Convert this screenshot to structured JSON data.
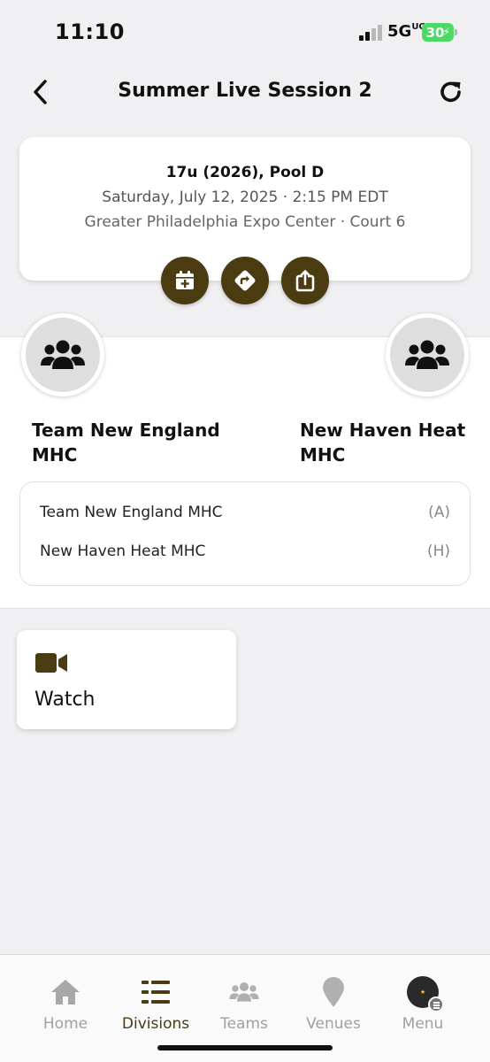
{
  "status_bar": {
    "time": "11:10",
    "network": "5G",
    "network_sup": "UC",
    "battery": "30"
  },
  "header": {
    "title": "Summer Live Session 2",
    "back_icon": "chevron-left-icon",
    "refresh_icon": "refresh-icon"
  },
  "game_info": {
    "division": "17u (2026), Pool D",
    "datetime": "Saturday, July 12, 2025 · 2:15 PM EDT",
    "venue": "Greater Philadelphia Expo Center · Court 6",
    "actions": [
      {
        "icon": "calendar-add-icon"
      },
      {
        "icon": "directions-icon"
      },
      {
        "icon": "share-icon"
      }
    ]
  },
  "teams": {
    "away": {
      "name_line1": "Team New England",
      "name_line2": "MHC",
      "icon": "group-icon"
    },
    "home": {
      "name_line1": "New Haven Heat",
      "name_line2": "MHC",
      "icon": "group-icon"
    }
  },
  "lineup": [
    {
      "name": "Team New England MHC",
      "side": "(A)"
    },
    {
      "name": "New Haven Heat MHC",
      "side": "(H)"
    }
  ],
  "watch": {
    "label": "Watch",
    "icon": "video-camera-icon"
  },
  "tab_bar": {
    "tabs": [
      {
        "label": "Home",
        "icon": "home-icon",
        "active": false
      },
      {
        "label": "Divisions",
        "icon": "list-icon",
        "active": true
      },
      {
        "label": "Teams",
        "icon": "teams-icon",
        "active": false
      },
      {
        "label": "Venues",
        "icon": "map-pin-icon",
        "active": false
      },
      {
        "label": "Menu",
        "icon": "menu-logo-icon",
        "active": false
      }
    ]
  },
  "colors": {
    "accent": "#4a3b10",
    "background": "#f0f0f2",
    "inactive_tab": "#a0a0a0",
    "battery": "#4cd964"
  }
}
